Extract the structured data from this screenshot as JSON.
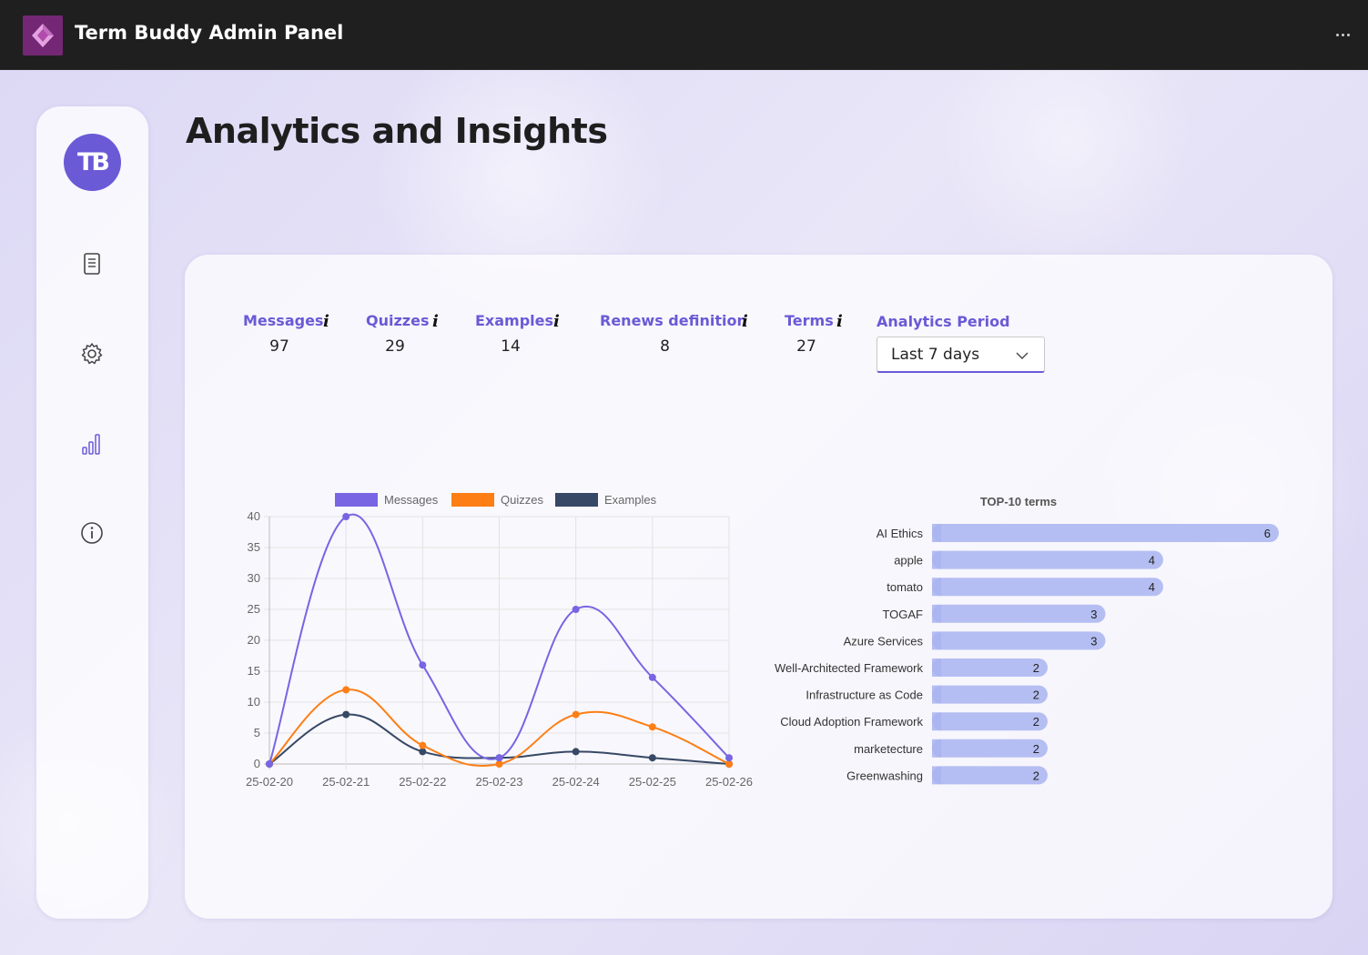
{
  "app": {
    "title": "Term Buddy Admin Panel"
  },
  "sidebar": {
    "avatar_text": "TB",
    "items": [
      {
        "icon": "document-icon"
      },
      {
        "icon": "gear-icon"
      },
      {
        "icon": "bar-chart-icon"
      },
      {
        "icon": "info-icon"
      }
    ]
  },
  "page": {
    "title": "Analytics and Insights"
  },
  "stats": [
    {
      "label": "Messages",
      "value": "97",
      "info": "i"
    },
    {
      "label": "Quizzes",
      "value": "29",
      "info": "i"
    },
    {
      "label": "Examples",
      "value": "14",
      "info": "i"
    },
    {
      "label": "Renews definition",
      "value": "8",
      "info": "i"
    },
    {
      "label": "Terms",
      "value": "27",
      "info": "i"
    }
  ],
  "period": {
    "label": "Analytics Period",
    "value": "Last 7 days"
  },
  "colors": {
    "accent": "#6a5ad6",
    "messages": "#7765e3",
    "quizzes": "#fd7e14",
    "examples": "#364865",
    "bar": "#a9b4f0"
  },
  "chart_data": [
    {
      "type": "line",
      "title": "",
      "x": [
        "25-02-20",
        "25-02-21",
        "25-02-22",
        "25-02-23",
        "25-02-24",
        "25-02-25",
        "25-02-26"
      ],
      "ylim": [
        0,
        40
      ],
      "yticks": [
        0,
        5,
        10,
        15,
        20,
        25,
        30,
        35,
        40
      ],
      "grid": true,
      "legend": "top",
      "series": [
        {
          "name": "Messages",
          "values": [
            0,
            40,
            16,
            1,
            25,
            14,
            1
          ]
        },
        {
          "name": "Quizzes",
          "values": [
            0,
            12,
            3,
            0,
            8,
            6,
            0
          ]
        },
        {
          "name": "Examples",
          "values": [
            0,
            8,
            2,
            1,
            2,
            1,
            0
          ]
        }
      ]
    },
    {
      "type": "bar",
      "orientation": "horizontal",
      "title": "TOP-10 terms",
      "categories": [
        "AI Ethics",
        "apple",
        "tomato",
        "TOGAF",
        "Azure Services",
        "Well-Architected Framework",
        "Infrastructure as Code",
        "Cloud Adoption Framework",
        "marketecture",
        "Greenwashing"
      ],
      "values": [
        6,
        4,
        4,
        3,
        3,
        2,
        2,
        2,
        2,
        2
      ],
      "xlim": [
        0,
        6
      ]
    }
  ]
}
